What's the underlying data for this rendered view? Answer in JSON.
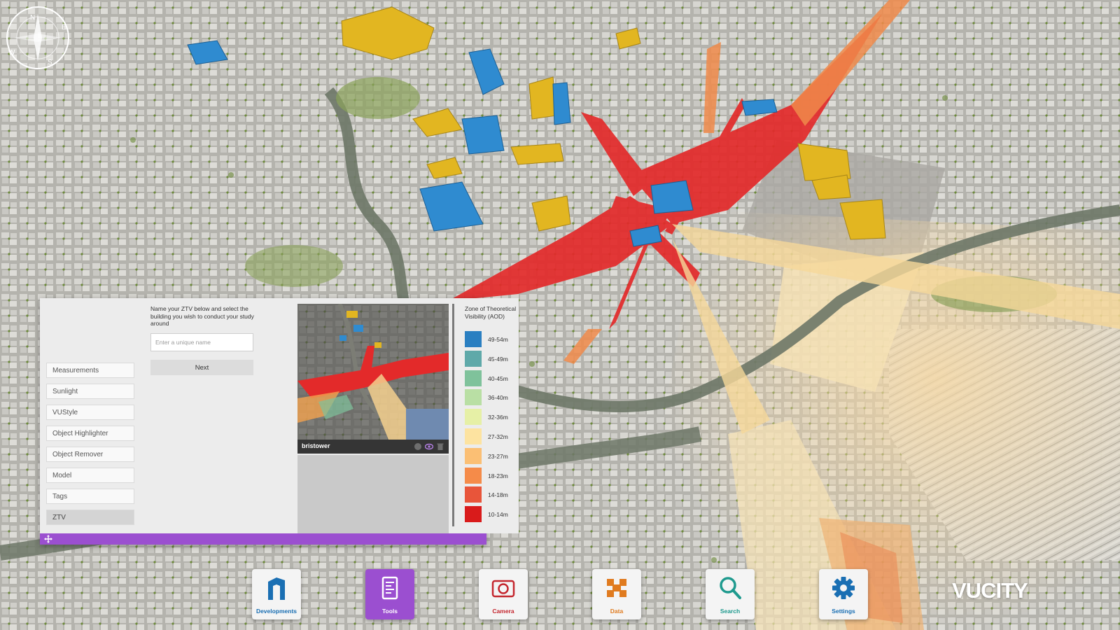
{
  "compass": {
    "n": "N",
    "e": "E",
    "s": "S",
    "w": "W"
  },
  "tools_menu": {
    "items": [
      {
        "label": "Measurements",
        "active": false
      },
      {
        "label": "Sunlight",
        "active": false
      },
      {
        "label": "VUStyle",
        "active": false
      },
      {
        "label": "Object Highlighter",
        "active": false
      },
      {
        "label": "Object Remover",
        "active": false
      },
      {
        "label": "Model",
        "active": false
      },
      {
        "label": "Tags",
        "active": false
      },
      {
        "label": "ZTV",
        "active": true
      }
    ]
  },
  "ztv_form": {
    "instructions": "Name your ZTV below and select the building you wish to conduct your study around",
    "name_placeholder": "Enter a unique name",
    "name_value": "",
    "next_label": "Next"
  },
  "preview": {
    "label": "bristower"
  },
  "legend": {
    "title": "Zone of Theoretical Visibility (AOD)",
    "items": [
      {
        "label": "49-54m",
        "color": "#2a7fc1"
      },
      {
        "label": "45-49m",
        "color": "#5fa9a9"
      },
      {
        "label": "40-45m",
        "color": "#7fc29b"
      },
      {
        "label": "36-40m",
        "color": "#b9dfa4"
      },
      {
        "label": "32-36m",
        "color": "#e6f0a6"
      },
      {
        "label": "27-32m",
        "color": "#fde3a0"
      },
      {
        "label": "23-27m",
        "color": "#fbbf74"
      },
      {
        "label": "18-23m",
        "color": "#f58b49"
      },
      {
        "label": "14-18m",
        "color": "#e8553a"
      },
      {
        "label": "10-14m",
        "color": "#d91b1b"
      }
    ]
  },
  "dock": {
    "items": [
      {
        "label": "Developments",
        "icon": "developments-icon",
        "color": "#1a6fb3",
        "active": false
      },
      {
        "label": "Tools",
        "icon": "tools-icon",
        "color": "#ffffff",
        "active": true
      },
      {
        "label": "Camera",
        "icon": "camera-icon",
        "color": "#c4262e",
        "active": false
      },
      {
        "label": "Data",
        "icon": "data-icon",
        "color": "#e07b1f",
        "active": false
      },
      {
        "label": "Search",
        "icon": "search-icon",
        "color": "#1f9a8e",
        "active": false
      },
      {
        "label": "Settings",
        "icon": "settings-icon",
        "color": "#1a6fb3",
        "active": false
      }
    ]
  },
  "brand": {
    "name": "VUCITY"
  },
  "colors": {
    "accent_purple": "#9b4fd0",
    "ztv_red": "#e32a2a",
    "development_yellow": "#e2b621",
    "development_blue": "#2f8bd0"
  }
}
